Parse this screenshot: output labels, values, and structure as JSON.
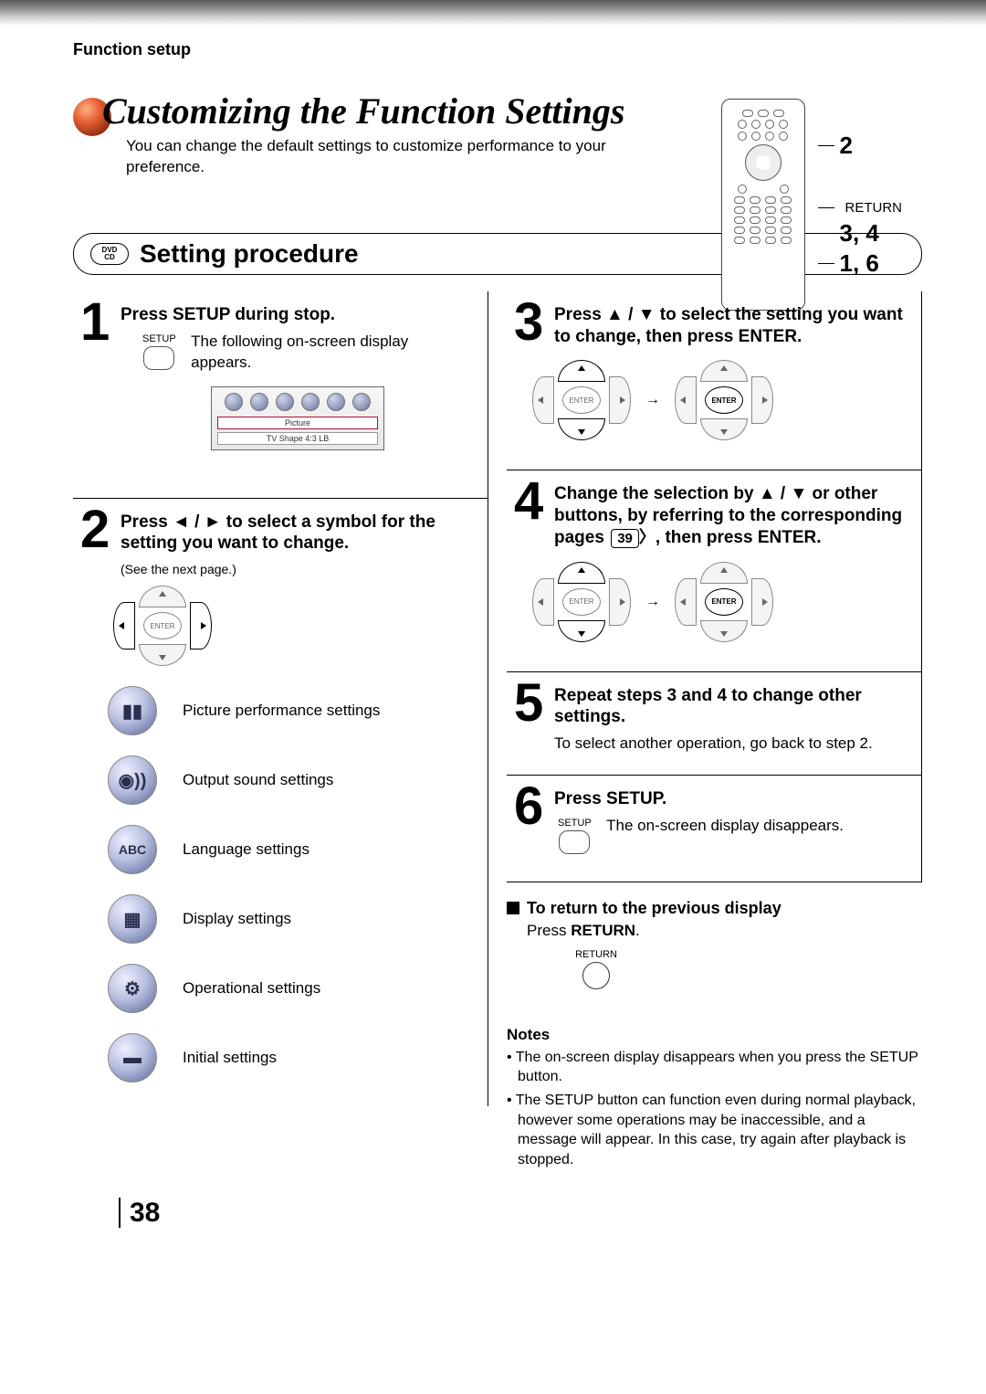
{
  "header": {
    "section": "Function setup"
  },
  "title": "Customizing the Function Settings",
  "intro": "You can change the default settings to customize performance to your preference.",
  "remote_callouts": {
    "c1": "2",
    "c_return": "RETURN",
    "c2": "3, 4",
    "c3": "1, 6"
  },
  "procedure": {
    "badge_top": "DVD",
    "badge_bottom": "CD",
    "title": "Setting procedure"
  },
  "steps": {
    "s1": {
      "num": "1",
      "heading": "Press SETUP during stop.",
      "setup_label": "SETUP",
      "body": "The following on-screen display appears."
    },
    "osd": {
      "line1": "Picture",
      "line2": "TV Shape   4:3 LB"
    },
    "s2": {
      "num": "2",
      "heading": "Press ◄ / ► to select a symbol for the setting you want to change.",
      "note": "(See the next page.)",
      "enter": "ENTER"
    },
    "categories": [
      {
        "glyph": "▮▮",
        "label": "Picture performance settings"
      },
      {
        "glyph": "◉))",
        "label": "Output sound settings"
      },
      {
        "glyph": "ABC",
        "label": "Language settings"
      },
      {
        "glyph": "▦",
        "label": "Display settings"
      },
      {
        "glyph": "⚙",
        "label": "Operational settings"
      },
      {
        "glyph": "▬",
        "label": "Initial settings"
      }
    ],
    "s3": {
      "num": "3",
      "heading": "Press ▲ / ▼ to select the setting you want to change, then press ENTER.",
      "enter": "ENTER"
    },
    "s4": {
      "num": "4",
      "heading_a": "Change the selection by ▲ / ▼ or other buttons, by referring to the corresponding pages ",
      "page_ref": "39",
      "heading_b": ", then press ENTER.",
      "enter": "ENTER"
    },
    "s5": {
      "num": "5",
      "heading": "Repeat steps 3 and 4 to change other settings.",
      "body": "To select another operation, go back to step 2."
    },
    "s6": {
      "num": "6",
      "heading": "Press SETUP.",
      "setup_label": "SETUP",
      "body": "The on-screen display disappears."
    }
  },
  "return_section": {
    "title": "To return to the previous display",
    "body_a": "Press ",
    "body_b": "RETURN",
    "body_c": ".",
    "label": "RETURN"
  },
  "notes": {
    "heading": "Notes",
    "items": [
      "The on-screen display disappears when you press the SETUP button.",
      "The SETUP button can function even during normal playback, however some operations may be inaccessible, and a message will appear. In this case, try again after playback is stopped."
    ]
  },
  "page_number": "38"
}
